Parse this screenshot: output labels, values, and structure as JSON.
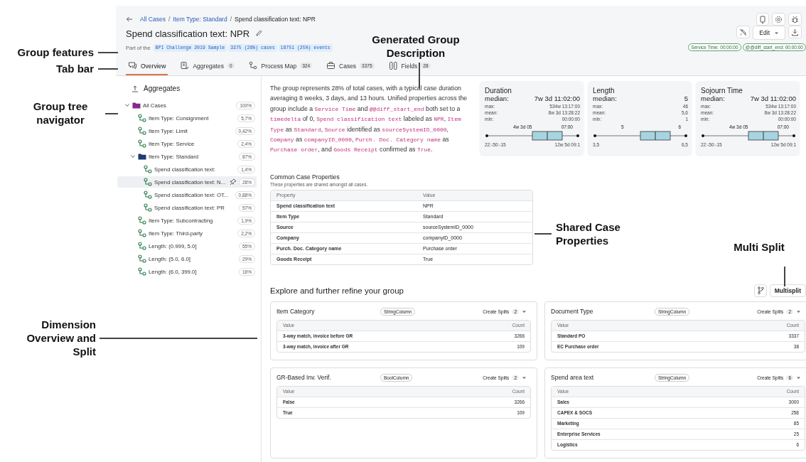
{
  "annotations": [
    {
      "text": "Group features"
    },
    {
      "text": "Tab bar"
    },
    {
      "text": "Group tree navigator"
    },
    {
      "text": "Generated Group Description"
    },
    {
      "text": "Shared Case Properties"
    },
    {
      "text": "Multi Split"
    },
    {
      "text": "Dimension Overview and Split"
    }
  ],
  "breadcrumb": {
    "separator": "/",
    "items": [
      {
        "label": "All Cases",
        "link": true
      },
      {
        "label": "Item Type: Standard",
        "link": true
      },
      {
        "label": "Spend classification text: NPR",
        "link": false
      }
    ]
  },
  "title": "Spend classification text: NPR",
  "features": {
    "prefix": "Part of the",
    "chips": [
      "BPI Challenge 2019 Sample",
      "3375 (28%) cases",
      "18751 (25%) events"
    ]
  },
  "edit_button": "Edit",
  "status_chips": [
    "Service Time: 00:00:00",
    "@@diff_start_end: 00:00:00"
  ],
  "tabs": [
    {
      "kind": "overview",
      "label": "Overview",
      "selected": true
    },
    {
      "kind": "aggregates",
      "label": "Aggregates",
      "count": "0",
      "selected": false
    },
    {
      "kind": "process-map",
      "label": "Process Map",
      "count": "324",
      "selected": false
    },
    {
      "kind": "cases",
      "label": "Cases",
      "count": "3375",
      "selected": false
    },
    {
      "kind": "fields",
      "label": "Fields",
      "count": "28",
      "selected": false
    }
  ],
  "sidebar": {
    "heading": "Aggregates",
    "tree": [
      {
        "kind": "folder",
        "color": "#86288a",
        "label": "All Cases",
        "badge": "100%",
        "selected": false,
        "expanded": true,
        "children": [
          {
            "kind": "group",
            "label": "Item Type: Consignment",
            "badge": "5,7%",
            "selected": false
          },
          {
            "kind": "group",
            "label": "Item Type: Limit",
            "badge": "0,42%",
            "selected": false
          },
          {
            "kind": "group",
            "label": "Item Type: Service",
            "badge": "2,4%",
            "selected": false
          },
          {
            "kind": "folder",
            "color": "#1d3a72",
            "label": "Item Type: Standard",
            "badge": "87%",
            "selected": false,
            "expanded": true,
            "children": [
              {
                "kind": "group",
                "label": "Spend classification text:",
                "badge": "1,4%",
                "selected": false
              },
              {
                "kind": "group",
                "label": "Spend classification text: N...",
                "badge": "28%",
                "selected": true
              },
              {
                "kind": "group",
                "label": "Spend classification text: OT...",
                "badge": "0,88%",
                "selected": false
              },
              {
                "kind": "group",
                "label": "Spend classification text: PR",
                "badge": "57%",
                "selected": false
              }
            ]
          },
          {
            "kind": "group",
            "label": "Item Type: Subcontracting",
            "badge": "1,9%",
            "selected": false
          },
          {
            "kind": "group",
            "label": "Item Type: Third-party",
            "badge": "2,2%",
            "selected": false
          },
          {
            "kind": "group",
            "label": "Length: (0.999, 5.0]",
            "badge": "55%",
            "selected": false
          },
          {
            "kind": "group",
            "label": "Length: (5.0, 6.0]",
            "badge": "29%",
            "selected": false
          },
          {
            "kind": "group",
            "label": "Length: (6.0, 399.0]",
            "badge": "16%",
            "selected": false
          }
        ]
      }
    ]
  },
  "description": [
    {
      "kind": "plain",
      "text": "The group represents 28% of total cases, with a typical case duration averaging 8 weeks, 3 days, and 13 hours. Unified properties across the group include a "
    },
    {
      "kind": "code",
      "text": "Service Time"
    },
    {
      "kind": "plain",
      "text": " and "
    },
    {
      "kind": "code",
      "text": "@@diff_start_end"
    },
    {
      "kind": "plain",
      "text": " both set to a "
    },
    {
      "kind": "code",
      "text": "timedelta"
    },
    {
      "kind": "plain",
      "text": " of 0, "
    },
    {
      "kind": "code",
      "text": "Spend classification text"
    },
    {
      "kind": "plain",
      "text": " labeled as "
    },
    {
      "kind": "code",
      "text": "NPR"
    },
    {
      "kind": "plain",
      "text": ", "
    },
    {
      "kind": "code",
      "text": "Item Type"
    },
    {
      "kind": "plain",
      "text": " as "
    },
    {
      "kind": "code",
      "text": "Standard"
    },
    {
      "kind": "plain",
      "text": ", "
    },
    {
      "kind": "code",
      "text": "Source"
    },
    {
      "kind": "plain",
      "text": " identified as "
    },
    {
      "kind": "code",
      "text": "sourceSystemID_0000"
    },
    {
      "kind": "plain",
      "text": ", "
    },
    {
      "kind": "code",
      "text": "Company"
    },
    {
      "kind": "plain",
      "text": " as "
    },
    {
      "kind": "code",
      "text": "companyID_0000"
    },
    {
      "kind": "plain",
      "text": ", "
    },
    {
      "kind": "code",
      "text": "Purch. Doc. Category name"
    },
    {
      "kind": "plain",
      "text": " as "
    },
    {
      "kind": "code",
      "text": "Purchase order"
    },
    {
      "kind": "plain",
      "text": ", and "
    },
    {
      "kind": "code",
      "text": "Goods Receipt"
    },
    {
      "kind": "plain",
      "text": " confirmed as "
    },
    {
      "kind": "code",
      "text": "True"
    },
    {
      "kind": "plain",
      "text": "."
    }
  ],
  "stats": [
    {
      "title": "Duration",
      "median_label": "median:",
      "median": "7w 3d 11:02:00",
      "rows": [
        {
          "label": "max:",
          "value": "534w 13:17:00"
        },
        {
          "label": "mean:",
          "value": "8w 3d 13:28:22"
        },
        {
          "label": "min:",
          "value": "00:00:00"
        }
      ],
      "plot": {
        "q1_label": "4w 3d 05",
        "q3_label": "07:00",
        "min_label": "22:-50:-15",
        "max_label": "12w 5d 09:1"
      }
    },
    {
      "title": "Length",
      "median_label": "median:",
      "median": "5",
      "rows": [
        {
          "label": "max:",
          "value": "46"
        },
        {
          "label": "mean:",
          "value": "5,6"
        },
        {
          "label": "min:",
          "value": "1"
        }
      ],
      "plot": {
        "q1_label": "5",
        "q3_label": "6",
        "min_label": "3,5",
        "max_label": "6,5"
      }
    },
    {
      "title": "Sojourn Time",
      "median_label": "median:",
      "median": "7w 3d 11:02:00",
      "rows": [
        {
          "label": "max:",
          "value": "534w 13:17:00"
        },
        {
          "label": "mean:",
          "value": "8w 3d 13:28:22"
        },
        {
          "label": "min:",
          "value": "00:00:00"
        }
      ],
      "plot": {
        "q1_label": "4w 3d 05",
        "q3_label": "07:00",
        "min_label": "22:-50:-15",
        "max_label": "12w 5d 09:1"
      }
    }
  ],
  "common_properties": {
    "title": "Common Case Properties",
    "subtitle": "These properties are shared amongst all cases.",
    "columns": [
      "Property",
      "Value"
    ],
    "rows": [
      [
        "Spend classification text",
        "NPR"
      ],
      [
        "Item Type",
        "Standard"
      ],
      [
        "Source",
        "sourceSystemID_0000"
      ],
      [
        "Company",
        "companyID_0000"
      ],
      [
        "Purch. Doc. Category name",
        "Purchase order"
      ],
      [
        "Goods Receipt",
        "True"
      ]
    ]
  },
  "explore": {
    "title": "Explore and further refine your group",
    "multisplit": "Multisplit",
    "cards": [
      {
        "title": "Item Category",
        "type": "StringColumn",
        "splits_label": "Create Splits",
        "splits": "2",
        "columns": [
          "Value",
          "Count"
        ],
        "rows": [
          [
            "3-way match, invoice before GR",
            "3266"
          ],
          [
            "3-way match, invoice after GR",
            "109"
          ]
        ]
      },
      {
        "title": "Document Type",
        "type": "StringColumn",
        "splits_label": "Create Splits",
        "splits": "2",
        "columns": [
          "Value",
          "Count"
        ],
        "rows": [
          [
            "Standard PO",
            "3337"
          ],
          [
            "EC Purchase order",
            "38"
          ]
        ]
      },
      {
        "title": "GR-Based Inv. Verif.",
        "type": "BoolColumn",
        "splits_label": "Create Splits",
        "splits": "2",
        "columns": [
          "Value",
          "Count"
        ],
        "rows": [
          [
            "False",
            "3266"
          ],
          [
            "True",
            "109"
          ]
        ]
      },
      {
        "title": "Spend area text",
        "type": "StringColumn",
        "splits_label": "Create Splits",
        "splits": "6",
        "columns": [
          "Value",
          "Count"
        ],
        "rows": [
          [
            "Sales",
            "3000"
          ],
          [
            "CAPEX & SOCS",
            "258"
          ],
          [
            "Marketing",
            "85"
          ],
          [
            "Enterprise Services",
            "25"
          ],
          [
            "Logistics",
            "6"
          ]
        ]
      }
    ]
  }
}
